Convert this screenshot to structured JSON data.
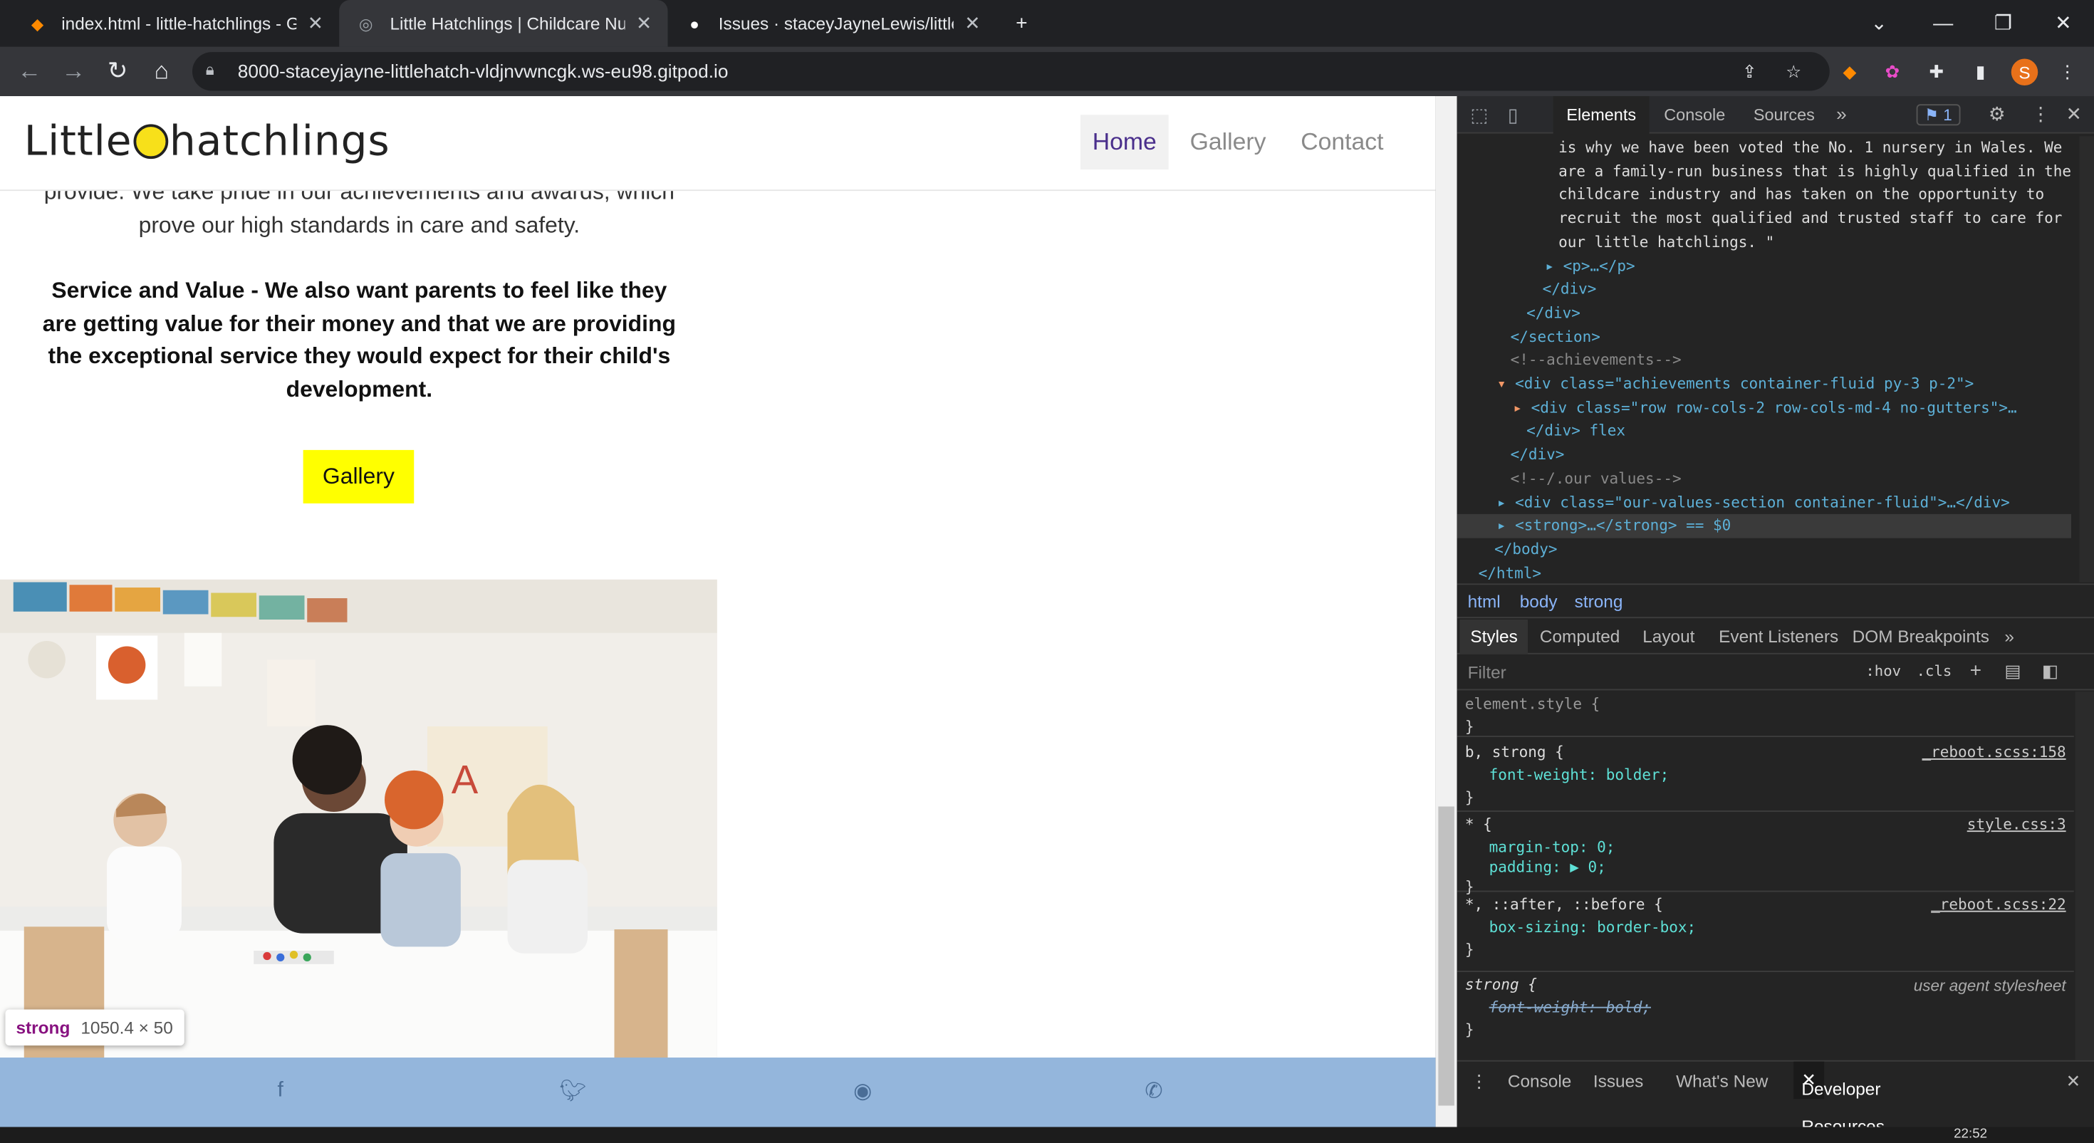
{
  "browser": {
    "tabs": [
      {
        "title": "index.html - little-hatchlings - Git",
        "icon": "gitpod-icon"
      },
      {
        "title": "Little Hatchlings | Childcare Nurse",
        "icon": "globe-icon"
      },
      {
        "title": "Issues · staceyJayneLewis/little-ha",
        "icon": "github-icon"
      }
    ],
    "url": "8000-staceyjayne-littlehatch-vldjnvwncgk.ws-eu98.gitpod.io",
    "profile_initial": "S"
  },
  "site": {
    "logo_text_left": "Little",
    "logo_text_right": "hatchlings",
    "nav": {
      "home": "Home",
      "gallery": "Gallery",
      "contact": "Contact"
    },
    "text_regular": "provide. We take pride in our achievements and awards, which prove our high standards in care and safety.",
    "text_bold": "Service and Value - We also want parents to feel like they are getting value for their money and that we are providing the exceptional service they would expect for their child's development.",
    "gallery_button": "Gallery",
    "tooltip": {
      "tag": "strong",
      "size": "1050.4 × 50"
    },
    "footer_icons": [
      "facebook-icon",
      "twitter-icon",
      "instagram-icon",
      "phone-icon"
    ]
  },
  "devtools": {
    "tabs": {
      "elements": "Elements",
      "console": "Console",
      "sources": "Sources"
    },
    "issues_count": "1",
    "dom_lines": [
      "is why we have been voted the No. 1 nursery in Wales. We",
      "are a family-run business that is highly qualified in the",
      "childcare industry and has taken on the opportunity to",
      "recruit the most qualified and trusted staff to care for",
      "our little hatchlings. \"",
      "<p>…</p>",
      "</div>",
      "</div>",
      "</section>",
      "<!--achievements-->",
      "<div class=\"achievements container-fluid py-3 p-2\">",
      "<div class=\"row row-cols-2 row-cols-md-4 no-gutters\">…",
      "</div> flex",
      "</div>",
      "<!--/.our values-->",
      "<div class=\"our-values-section container-fluid\">…</div>",
      "<strong>…</strong> == $0",
      "</body>",
      "</html>"
    ],
    "breadcrumbs": [
      "html",
      "body",
      "strong"
    ],
    "style_tabs": [
      "Styles",
      "Computed",
      "Layout",
      "Event Listeners",
      "DOM Breakpoints"
    ],
    "filter_placeholder": "Filter",
    "hov": ":hov",
    "cls": ".cls",
    "rules": [
      {
        "selector": "element.style {",
        "source": "",
        "props": []
      },
      {
        "selector": "b, strong {",
        "source": "_reboot.scss:158",
        "props": [
          "font-weight: bolder;"
        ]
      },
      {
        "selector": "* {",
        "source": "style.css:3",
        "props": [
          "margin-top: 0;",
          "padding: ▶ 0;"
        ]
      },
      {
        "selector": "*, ::after, ::before {",
        "source": "_reboot.scss:22",
        "props": [
          "box-sizing: border-box;"
        ]
      },
      {
        "selector": "strong {",
        "source": "user agent stylesheet",
        "props": [
          "font-weight: bold;"
        ]
      }
    ],
    "drawer_tabs": [
      "Console",
      "Issues",
      "What's New",
      "Developer Resources"
    ]
  },
  "taskbar": {
    "time": "22:52"
  }
}
